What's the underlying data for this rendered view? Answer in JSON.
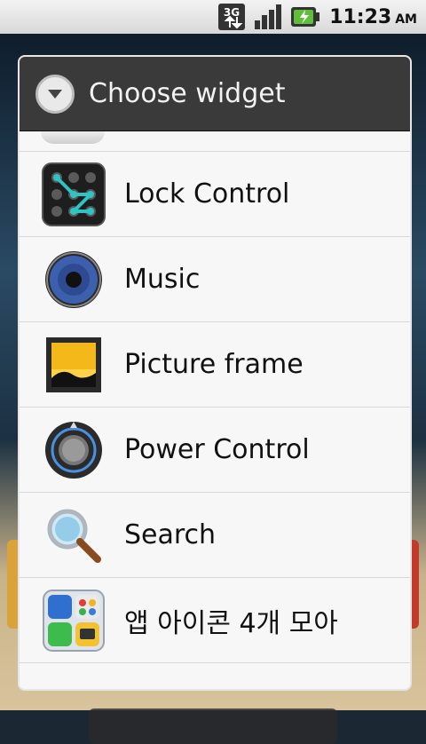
{
  "status_bar": {
    "network": "3G",
    "time": "11:23",
    "ampm": "AM"
  },
  "dialog": {
    "title": "Choose widget",
    "items": [
      {
        "label": "Lock Control",
        "icon": "pattern-lock-icon"
      },
      {
        "label": "Music",
        "icon": "speaker-icon"
      },
      {
        "label": "Picture frame",
        "icon": "picture-frame-icon"
      },
      {
        "label": "Power Control",
        "icon": "power-knob-icon"
      },
      {
        "label": "Search",
        "icon": "magnifier-icon"
      },
      {
        "label": "앱 아이콘  4개 모아",
        "icon": "app-folder-icon"
      }
    ]
  }
}
